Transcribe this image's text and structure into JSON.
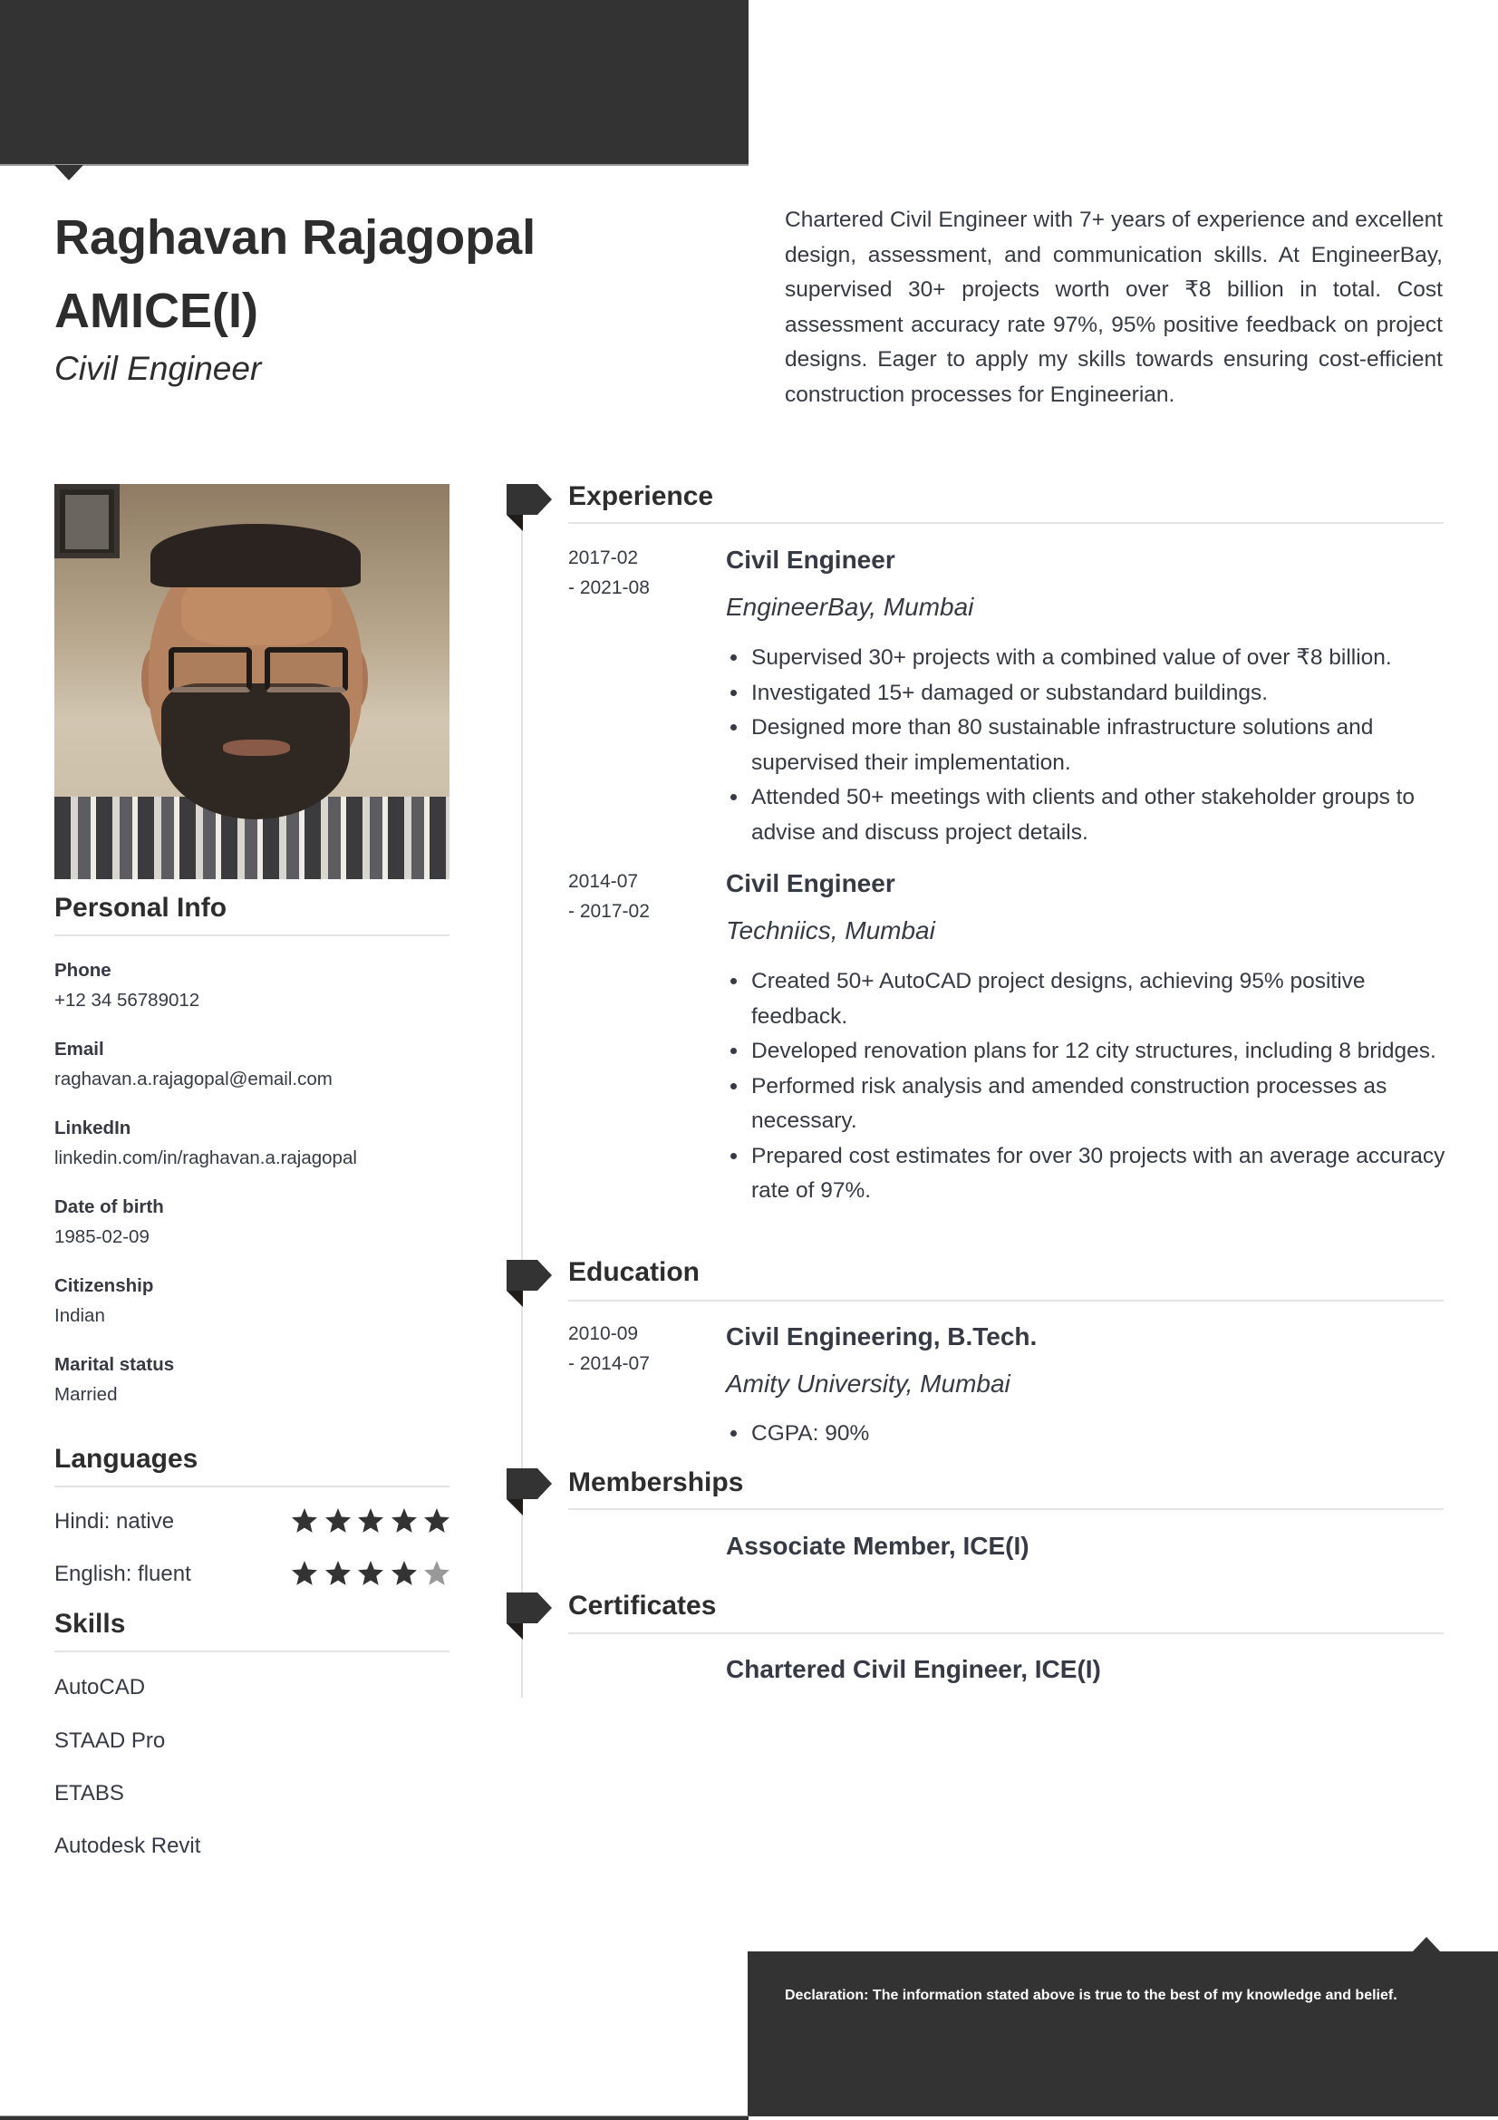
{
  "header": {
    "name_line1": "Raghavan Rajagopal",
    "name_line2": "AMICE(I)",
    "job_title": "Civil Engineer",
    "summary": "Chartered Civil Engineer with 7+ years of experience and excellent design, assessment, and communication skills. At EngineerBay, supervised 30+ projects worth over ₹8 billion in total. Cost assessment accuracy rate 97%, 95% positive feedback on project designs. Eager to apply my skills towards ensuring cost-efficient construction processes for Engineerian."
  },
  "photo": {
    "alt": "Profile photo of Raghavan Rajagopal"
  },
  "personal_info": {
    "heading": "Personal Info",
    "items": [
      {
        "label": "Phone",
        "value": "+12 34 56789012"
      },
      {
        "label": "Email",
        "value": "raghavan.a.rajagopal@email.com"
      },
      {
        "label": "LinkedIn",
        "value": "linkedin.com/in/raghavan.a.rajagopal"
      },
      {
        "label": "Date of birth",
        "value": "1985-02-09"
      },
      {
        "label": "Citizenship",
        "value": "Indian"
      },
      {
        "label": "Marital status",
        "value": "Married"
      }
    ]
  },
  "languages": {
    "heading": "Languages",
    "items": [
      {
        "label": "Hindi: native",
        "rating": 5,
        "max": 5
      },
      {
        "label": "English: fluent",
        "rating": 4,
        "max": 5
      }
    ]
  },
  "skills": {
    "heading": "Skills",
    "items": [
      "AutoCAD",
      "STAAD Pro",
      "ETABS",
      "Autodesk Revit"
    ]
  },
  "experience": {
    "heading": "Experience",
    "jobs": [
      {
        "date_start": "2017-02",
        "date_end": "- 2021-08",
        "title": "Civil Engineer",
        "company": "EngineerBay, Mumbai",
        "bullets": [
          "Supervised 30+ projects with a combined value of over ₹8 billion.",
          "Investigated 15+ damaged or substandard buildings.",
          "Designed more than 80 sustainable infrastructure solutions and supervised their implementation.",
          "Attended 50+ meetings with clients and other stakeholder groups to advise and discuss project details."
        ]
      },
      {
        "date_start": "2014-07",
        "date_end": "- 2017-02",
        "title": "Civil Engineer",
        "company": "Techniics, Mumbai",
        "bullets": [
          "Created 50+ AutoCAD project designs, achieving 95% positive feedback.",
          "Developed renovation plans for 12 city structures, including 8 bridges.",
          "Performed risk analysis and amended construction processes as necessary.",
          "Prepared cost estimates for over 30 projects with an average accuracy rate of 97%."
        ]
      }
    ]
  },
  "education": {
    "heading": "Education",
    "items": [
      {
        "date_start": "2010-09",
        "date_end": "- 2014-07",
        "degree": "Civil Engineering, B.Tech.",
        "school": "Amity University, Mumbai",
        "bullets": [
          "CGPA: 90%"
        ]
      }
    ]
  },
  "memberships": {
    "heading": "Memberships",
    "items": [
      "Associate Member, ICE(I)"
    ]
  },
  "certificates": {
    "heading": "Certificates",
    "items": [
      "Chartered Civil Engineer, ICE(I)"
    ]
  },
  "footer": {
    "declaration": "Declaration: The information stated above is true to the best of my knowledge and belief."
  },
  "colors": {
    "dark": "#333333",
    "text": "#353a44",
    "rule": "#e3e3e3",
    "star_filled": "#333333",
    "star_empty": "#999999"
  }
}
